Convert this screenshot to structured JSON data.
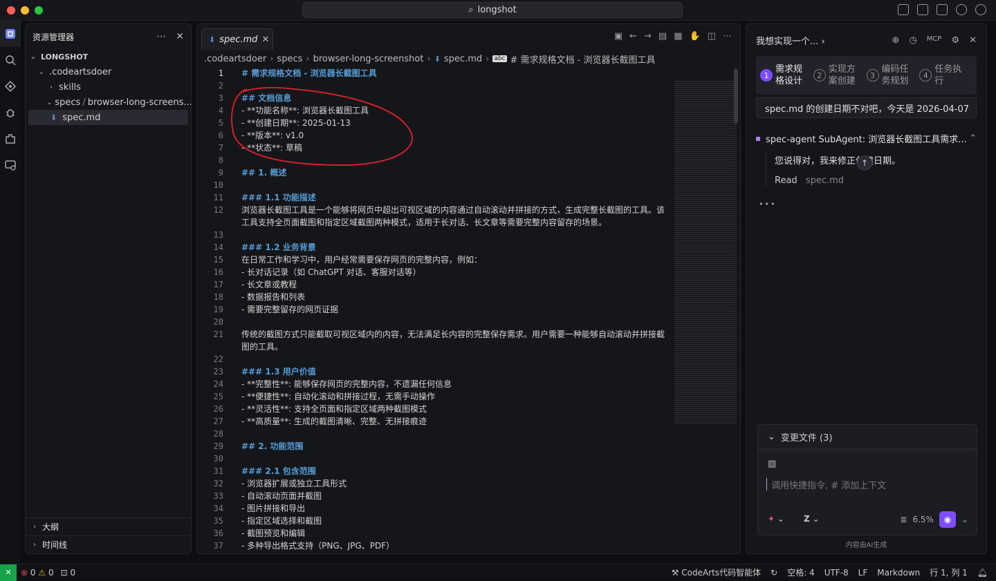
{
  "window": {
    "search_text": "longshot"
  },
  "explorer": {
    "title": "资源管理器",
    "root": "LONGSHOT",
    "items": [
      ".codeartsdoer",
      "skills",
      "specs",
      "browser-long-screens...",
      "spec.md"
    ],
    "outline_label": "大纲",
    "timeline_label": "时间线"
  },
  "editor": {
    "tab_label": "spec.md",
    "breadcrumbs": [
      ".codeartsdoer",
      "specs",
      "browser-long-screenshot",
      "spec.md",
      "# 需求规格文档 - 浏览器长截图工具"
    ],
    "lines": [
      {
        "n": "1",
        "t": "# 需求规格文档 - 浏览器长截图工具",
        "h": true
      },
      {
        "n": "2",
        "t": ""
      },
      {
        "n": "3",
        "t": "## 文档信息",
        "h": true
      },
      {
        "n": "4",
        "t": "- **功能名称**: 浏览器长截图工具"
      },
      {
        "n": "5",
        "t": "- **创建日期**: 2025-01-13"
      },
      {
        "n": "6",
        "t": "- **版本**: v1.0"
      },
      {
        "n": "7",
        "t": "- **状态**: 草稿"
      },
      {
        "n": "8",
        "t": ""
      },
      {
        "n": "9",
        "t": "## 1. 概述",
        "h": true
      },
      {
        "n": "10",
        "t": ""
      },
      {
        "n": "11",
        "t": "### 1.1 功能描述",
        "h": true
      },
      {
        "n": "12",
        "t": "浏览器长截图工具是一个能够将网页中超出可视区域的内容通过自动滚动并拼接的方式，生成完整长截图的工具。该工具支持全页面截图和指定区域截图两种模式，适用于长对话、长文章等需要完整内容留存的场景。",
        "tall": true
      },
      {
        "n": "13",
        "t": ""
      },
      {
        "n": "14",
        "t": "### 1.2 业务背景",
        "h": true
      },
      {
        "n": "15",
        "t": "在日常工作和学习中，用户经常需要保存网页的完整内容，例如："
      },
      {
        "n": "16",
        "t": "- 长对话记录（如 ChatGPT 对话、客服对话等）"
      },
      {
        "n": "17",
        "t": "- 长文章或教程"
      },
      {
        "n": "18",
        "t": "- 数据报告和列表"
      },
      {
        "n": "19",
        "t": "- 需要完整留存的网页证据"
      },
      {
        "n": "20",
        "t": ""
      },
      {
        "n": "21",
        "t": "传统的截图方式只能截取可视区域内的内容，无法满足长内容的完整保存需求。用户需要一种能够自动滚动并拼接截图的工具。",
        "tall": true
      },
      {
        "n": "22",
        "t": ""
      },
      {
        "n": "23",
        "t": "### 1.3 用户价值",
        "h": true
      },
      {
        "n": "24",
        "t": "- **完整性**: 能够保存网页的完整内容，不遗漏任何信息"
      },
      {
        "n": "25",
        "t": "- **便捷性**: 自动化滚动和拼接过程，无需手动操作"
      },
      {
        "n": "26",
        "t": "- **灵活性**: 支持全页面和指定区域两种截图模式"
      },
      {
        "n": "27",
        "t": "- **高质量**: 生成的截图清晰、完整、无拼接痕迹"
      },
      {
        "n": "28",
        "t": ""
      },
      {
        "n": "29",
        "t": "## 2. 功能范围",
        "h": true
      },
      {
        "n": "30",
        "t": ""
      },
      {
        "n": "31",
        "t": "### 2.1 包含范围",
        "h": true
      },
      {
        "n": "32",
        "t": "- 浏览器扩展或独立工具形式"
      },
      {
        "n": "33",
        "t": "- 自动滚动页面并截图"
      },
      {
        "n": "34",
        "t": "- 图片拼接和导出"
      },
      {
        "n": "35",
        "t": "- 指定区域选择和截图"
      },
      {
        "n": "36",
        "t": "- 截图预览和编辑"
      },
      {
        "n": "37",
        "t": "- 多种导出格式支持（PNG、JPG、PDF）"
      }
    ]
  },
  "chat": {
    "title": "我想实现一个...",
    "steps": [
      {
        "num": "1",
        "label": "需求规格设计"
      },
      {
        "num": "2",
        "label": "实现方案创建"
      },
      {
        "num": "3",
        "label": "编码任务规划"
      },
      {
        "num": "4",
        "label": "任务执行"
      }
    ],
    "user_message": "spec.md 的创建日期不对吧，今天是 2026-04-07",
    "agent_title": "spec-agent SubAgent: 浏览器长截图工具需求...",
    "agent_reply": "您说得对，我来修正创建日期。",
    "read_label": "Read",
    "read_file": "spec.md",
    "changed_files": "变更文件 (3)",
    "input_placeholder": "调用快捷指令, # 添加上下文",
    "usage": "6.5%",
    "footer": "内容由AI生成"
  },
  "status": {
    "errors": "0",
    "warnings": "0",
    "ports": "0",
    "agent": "CodeArts代码智能体",
    "spaces": "空格: 4",
    "encoding": "UTF-8",
    "eol": "LF",
    "language": "Markdown",
    "position": "行 1, 列 1"
  },
  "colors": {
    "accent": "#7c4dff",
    "heading": "#569cd6",
    "annotation": "#d0202a"
  }
}
